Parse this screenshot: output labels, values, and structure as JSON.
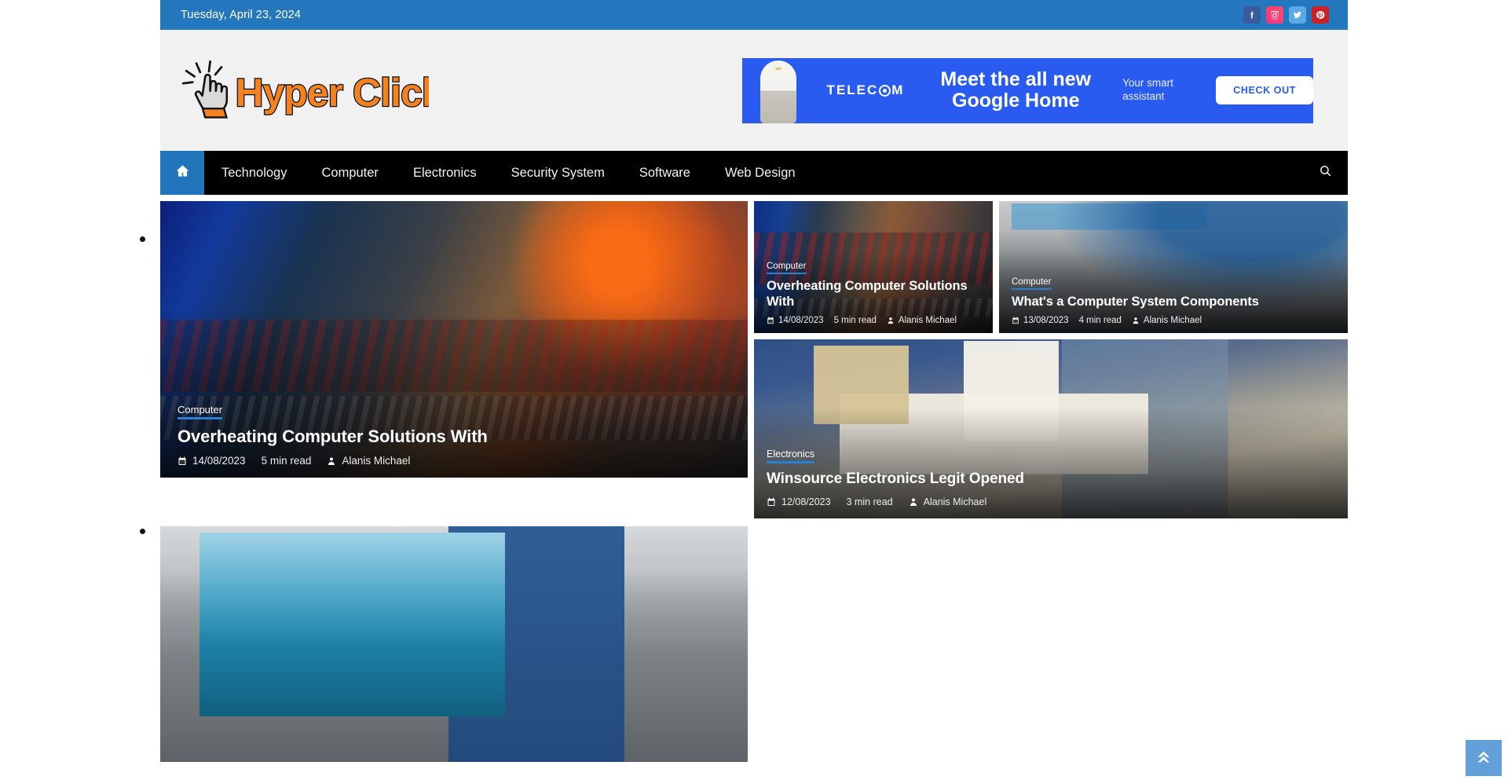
{
  "topbar": {
    "date": "Tuesday, April 23, 2024",
    "socials": [
      {
        "name": "facebook",
        "label": "Facebook"
      },
      {
        "name": "instagram",
        "label": "Instagram"
      },
      {
        "name": "twitter",
        "label": "Twitter"
      },
      {
        "name": "pinterest",
        "label": "Pinterest"
      }
    ]
  },
  "header": {
    "logo_text": "Hyper Click",
    "banner": {
      "brand": "TELEC",
      "brand_tail": "M",
      "headline_line1": "Meet the all new",
      "headline_line2": "Google Home",
      "subtext": "Your smart assistant",
      "cta": "CHECK OUT"
    }
  },
  "nav": {
    "home_icon": "home-icon",
    "items": [
      {
        "label": "Technology"
      },
      {
        "label": "Computer"
      },
      {
        "label": "Electronics"
      },
      {
        "label": "Security System"
      },
      {
        "label": "Software"
      },
      {
        "label": "Web Design"
      }
    ],
    "search_icon": "search-icon"
  },
  "posts": {
    "featured": {
      "category": "Computer",
      "title": "Overheating Computer Solutions With",
      "date": "14/08/2023",
      "read_time": "5 min read",
      "author": "Alanis Michael"
    },
    "small_left": {
      "category": "Computer",
      "title": "Overheating Computer Solutions With",
      "date": "14/08/2023",
      "read_time": "5 min read",
      "author": "Alanis Michael"
    },
    "small_right": {
      "category": "Computer",
      "title": "What's a Computer System Components",
      "date": "13/08/2023",
      "read_time": "4 min read",
      "author": "Alanis Michael"
    },
    "wide": {
      "category": "Electronics",
      "title": "Winsource Electronics Legit Opened",
      "date": "12/08/2023",
      "read_time": "3 min read",
      "author": "Alanis Michael"
    }
  },
  "back_to_top": {
    "icon": "double-chevron-up-icon"
  },
  "colors": {
    "topbar_blue": "#2476bd",
    "nav_black": "#000000",
    "accent_blue": "#2175bb",
    "header_gray": "#f1f1f1",
    "banner_blue": "#2a5bf0",
    "logo_orange": "#f58220",
    "back_to_top": "#61a0d8"
  }
}
